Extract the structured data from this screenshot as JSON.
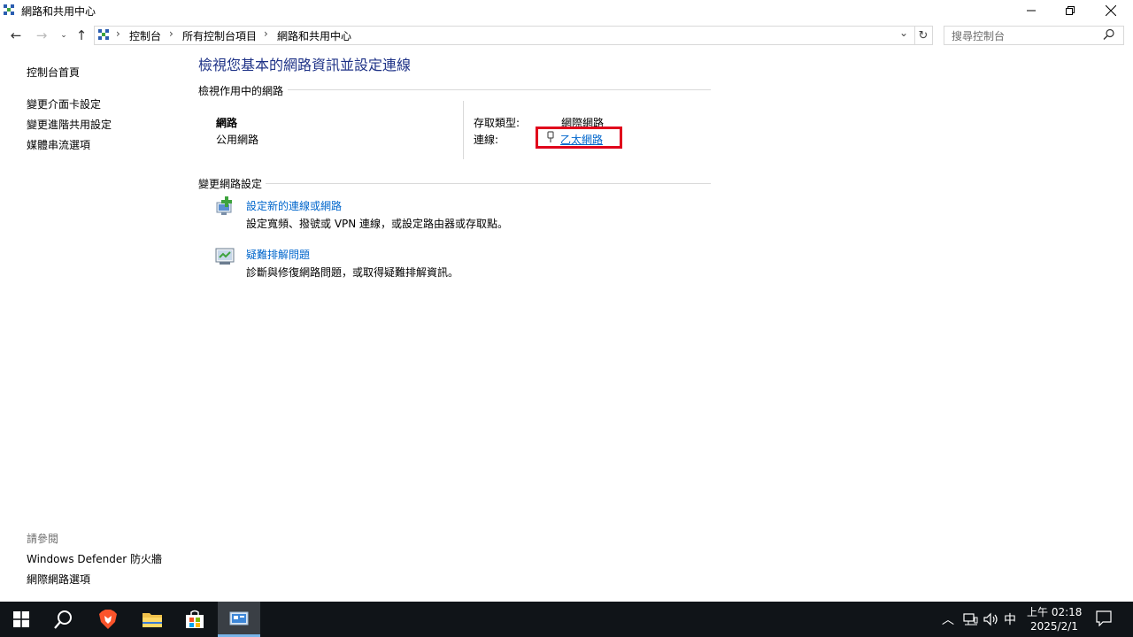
{
  "window": {
    "title": "網路和共用中心"
  },
  "breadcrumb": {
    "items": [
      "控制台",
      "所有控制台項目",
      "網路和共用中心"
    ]
  },
  "search": {
    "placeholder": "搜尋控制台"
  },
  "left_pane": {
    "home": "控制台首頁",
    "links": [
      "變更介面卡設定",
      "變更進階共用設定",
      "媒體串流選項"
    ],
    "see_also_heading": "請參閱",
    "see_also": [
      "Windows Defender 防火牆",
      "網際網路選項"
    ]
  },
  "main": {
    "title": "檢視您基本的網路資訊並設定連線",
    "active_networks_heading": "檢視作用中的網路",
    "network": {
      "name": "網路",
      "profile": "公用網路",
      "access_type_label": "存取類型:",
      "access_type_value": "網際網路",
      "connections_label": "連線:",
      "connection_value": "乙太網路"
    },
    "change_settings_heading": "變更網路設定",
    "tasks": [
      {
        "title": "設定新的連線或網路",
        "desc": "設定寬頻、撥號或 VPN 連線，或設定路由器或存取點。",
        "icon": "new-connection-icon"
      },
      {
        "title": "疑難排解問題",
        "desc": "診斷與修復網路問題，或取得疑難排解資訊。",
        "icon": "troubleshoot-icon"
      }
    ]
  },
  "taskbar": {
    "ime": "中",
    "time": "上午 02:18",
    "date": "2025/2/1"
  },
  "colors": {
    "title_blue": "#1e3287",
    "link_blue": "#0066cc",
    "highlight_red": "#e0001b",
    "taskbar_bg": "#101418"
  }
}
